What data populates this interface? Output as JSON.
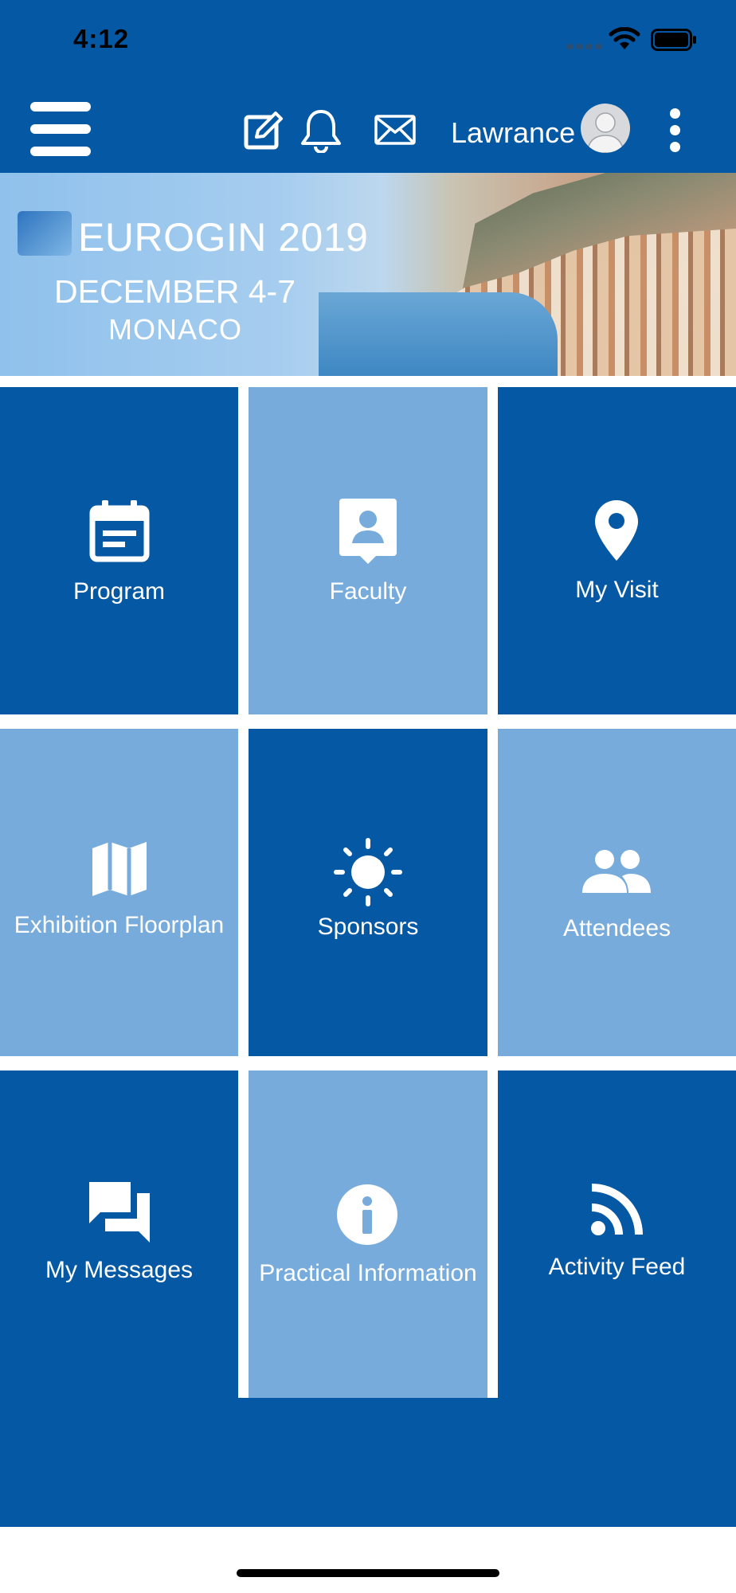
{
  "status_bar": {
    "time": "4:12"
  },
  "header": {
    "user_name": "Lawrance"
  },
  "banner": {
    "title": "EUROGIN 2019",
    "dates": "DECEMBER 4-7",
    "location": "MONACO"
  },
  "tiles": [
    {
      "label": "Program",
      "icon": "calendar-icon"
    },
    {
      "label": "Faculty",
      "icon": "contact-card-icon"
    },
    {
      "label": "My Visit",
      "icon": "map-pin-icon"
    },
    {
      "label": "Exhibition Floorplan",
      "icon": "map-icon"
    },
    {
      "label": "Sponsors",
      "icon": "sun-icon"
    },
    {
      "label": "Attendees",
      "icon": "people-icon"
    },
    {
      "label": "My Messages",
      "icon": "chat-bubbles-icon"
    },
    {
      "label": "Practical Information",
      "icon": "info-icon"
    },
    {
      "label": "Activity Feed",
      "icon": "rss-icon"
    }
  ],
  "colors": {
    "primary": "#0458A4",
    "light_tile": "#77ABDB"
  }
}
